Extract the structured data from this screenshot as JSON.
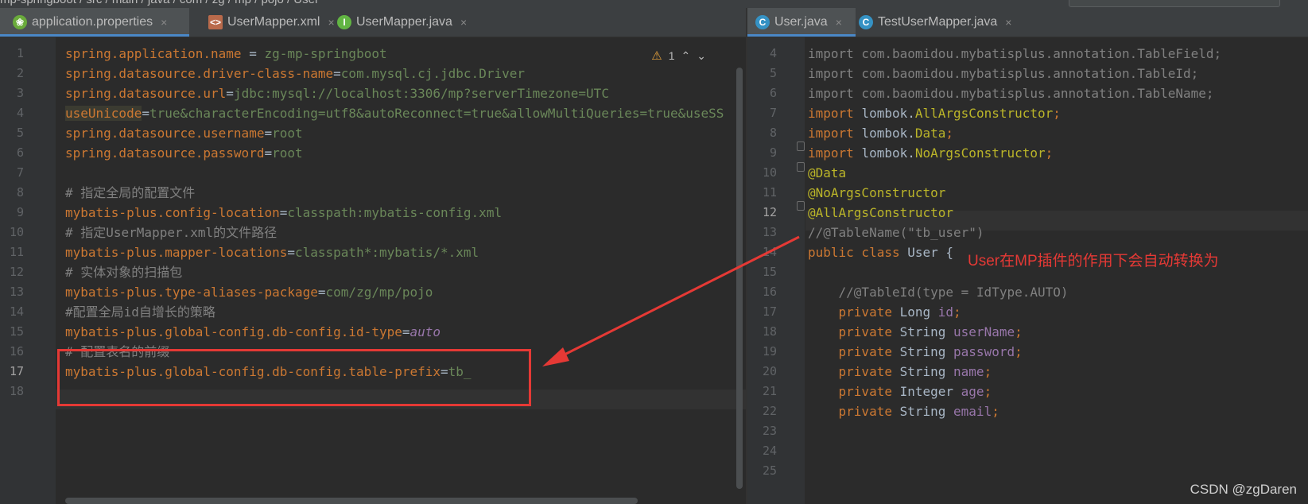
{
  "breadcrumb": "mp-springboot  /  src  /  main  /  java  /  com  /  zg  /  mp  /  pojo  /  User",
  "left_tabs": [
    {
      "label": "application.properties",
      "icon": "spring-leaf-icon",
      "active": true
    },
    {
      "label": "UserMapper.xml",
      "icon": "xml-file-icon",
      "active": false
    },
    {
      "label": "UserMapper.java",
      "icon": "interface-icon",
      "active": false
    }
  ],
  "right_tabs": [
    {
      "label": "User.java",
      "icon": "class-icon",
      "active": true
    },
    {
      "label": "TestUserMapper.java",
      "icon": "test-class-icon",
      "active": false
    }
  ],
  "close_glyph": "×",
  "warning_count": "1",
  "left_line_numbers": [
    "1",
    "2",
    "3",
    "4",
    "5",
    "6",
    "7",
    "8",
    "9",
    "10",
    "11",
    "12",
    "13",
    "14",
    "15",
    "16",
    "17",
    "18"
  ],
  "left_lines": [
    [
      [
        "key",
        "spring.application.name"
      ],
      [
        "eq",
        " = "
      ],
      [
        "val",
        "zg-mp-springboot"
      ]
    ],
    [
      [
        "key",
        "spring.datasource.driver-class-name"
      ],
      [
        "eq",
        "="
      ],
      [
        "val",
        "com.mysql.cj.jdbc.Driver"
      ]
    ],
    [
      [
        "key",
        "spring.datasource.url"
      ],
      [
        "eq",
        "="
      ],
      [
        "val",
        "jdbc:mysql://localhost:3306/mp?serverTimezone=UTC"
      ]
    ],
    [
      [
        "key hl-unused",
        "useUnicode"
      ],
      [
        "eq",
        "="
      ],
      [
        "val",
        "true&characterEncoding=utf8&autoReconnect=true&allowMultiQueries=true&useSS"
      ]
    ],
    [
      [
        "key",
        "spring.datasource.username"
      ],
      [
        "eq",
        "="
      ],
      [
        "val",
        "root"
      ]
    ],
    [
      [
        "key",
        "spring.datasource.password"
      ],
      [
        "eq",
        "="
      ],
      [
        "val",
        "root"
      ]
    ],
    [],
    [
      [
        "cmt",
        "# 指定全局的配置文件"
      ]
    ],
    [
      [
        "key",
        "mybatis-plus.config-location"
      ],
      [
        "eq",
        "="
      ],
      [
        "val",
        "classpath:mybatis-config.xml"
      ]
    ],
    [
      [
        "cmt",
        "# 指定UserMapper.xml的文件路径"
      ]
    ],
    [
      [
        "key",
        "mybatis-plus.mapper-locations"
      ],
      [
        "eq",
        "="
      ],
      [
        "val",
        "classpath*:mybatis/*.xml"
      ]
    ],
    [
      [
        "cmt",
        "# 实体对象的扫描包"
      ]
    ],
    [
      [
        "key",
        "mybatis-plus.type-aliases-package"
      ],
      [
        "eq",
        "="
      ],
      [
        "val",
        "com/zg/mp/pojo"
      ]
    ],
    [
      [
        "cmt",
        "#配置全局id自增长的策略"
      ]
    ],
    [
      [
        "key",
        "mybatis-plus.global-config.db-config.id-type"
      ],
      [
        "eq",
        "="
      ],
      [
        "italic",
        "auto"
      ]
    ],
    [
      [
        "cmt",
        "# 配置表名的前缀"
      ]
    ],
    [
      [
        "key",
        "mybatis-plus.global-config.db-config.table-prefix"
      ],
      [
        "eq",
        "="
      ],
      [
        "val",
        "tb_"
      ]
    ],
    []
  ],
  "right_line_numbers": [
    "4",
    "5",
    "6",
    "7",
    "8",
    "9",
    "10",
    "11",
    "12",
    "13",
    "14",
    "15",
    "16",
    "17",
    "18",
    "19",
    "20",
    "21",
    "22",
    "23",
    "24",
    "25"
  ],
  "right_lines": [
    [
      [
        "cmt",
        "import com.baomidou.mybatisplus.annotation.TableField;"
      ]
    ],
    [
      [
        "cmt",
        "import com.baomidou.mybatisplus.annotation.TableId;"
      ]
    ],
    [
      [
        "cmt",
        "import com.baomidou.mybatisplus.annotation.TableName;"
      ]
    ],
    [
      [
        "kw",
        "import "
      ],
      [
        "eq",
        "lombok."
      ],
      [
        "ann",
        "AllArgsConstructor"
      ],
      [
        "kw",
        ";"
      ]
    ],
    [
      [
        "kw",
        "import "
      ],
      [
        "eq",
        "lombok."
      ],
      [
        "ann",
        "Data"
      ],
      [
        "kw",
        ";"
      ]
    ],
    [
      [
        "kw",
        "import "
      ],
      [
        "eq",
        "lombok."
      ],
      [
        "ann",
        "NoArgsConstructor"
      ],
      [
        "kw",
        ";"
      ]
    ],
    [
      [
        "ann",
        "@Data"
      ]
    ],
    [
      [
        "ann",
        "@NoArgsConstructor"
      ]
    ],
    [
      [
        "ann",
        "@AllArgsConstructor"
      ]
    ],
    [
      [
        "cmt",
        "//@TableName(\"tb_user\")"
      ]
    ],
    [
      [
        "kw",
        "public class "
      ],
      [
        "eq",
        "User { "
      ]
    ],
    [],
    [
      [
        "cmt",
        "    //@TableId(type = IdType.AUTO)"
      ]
    ],
    [
      [
        "kw",
        "    private "
      ],
      [
        "eq",
        "Long "
      ],
      [
        "field",
        "id"
      ],
      [
        "kw",
        ";"
      ]
    ],
    [
      [
        "kw",
        "    private "
      ],
      [
        "eq",
        "String "
      ],
      [
        "field",
        "userName"
      ],
      [
        "kw",
        ";"
      ]
    ],
    [
      [
        "kw",
        "    private "
      ],
      [
        "eq",
        "String "
      ],
      [
        "field",
        "password"
      ],
      [
        "kw",
        ";"
      ]
    ],
    [
      [
        "kw",
        "    private "
      ],
      [
        "eq",
        "String "
      ],
      [
        "field",
        "name"
      ],
      [
        "kw",
        ";"
      ]
    ],
    [
      [
        "kw",
        "    private "
      ],
      [
        "eq",
        "Integer "
      ],
      [
        "field",
        "age"
      ],
      [
        "kw",
        ";"
      ]
    ],
    [
      [
        "kw",
        "    private "
      ],
      [
        "eq",
        "String "
      ],
      [
        "field",
        "email"
      ],
      [
        "kw",
        ";"
      ]
    ],
    [],
    [],
    []
  ],
  "annotation_text": "User在MP插件的作用下会自动转换为",
  "watermark": "CSDN @zgDaren",
  "colors": {
    "annotation": "#e53935",
    "accent": "#4a88c7"
  }
}
